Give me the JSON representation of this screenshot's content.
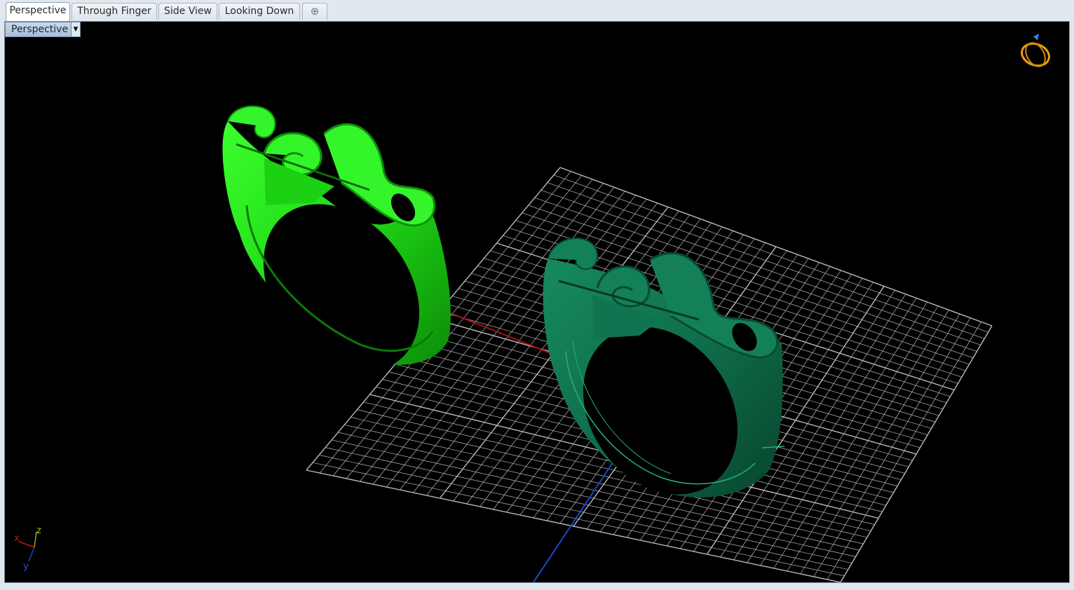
{
  "tabs": [
    {
      "label": "Perspective",
      "active": true
    },
    {
      "label": "Through Finger",
      "active": false
    },
    {
      "label": "Side View",
      "active": false
    },
    {
      "label": "Looking Down",
      "active": false
    }
  ],
  "add_tab_icon": "plus-icon",
  "viewport": {
    "title": "Perspective",
    "dropdown_icon": "triangle-down-icon",
    "navigator_icon": "rotate-ring-icon",
    "axis_triad": {
      "x": "x",
      "y": "y",
      "z": "z"
    }
  },
  "scene": {
    "objects": [
      {
        "name": "ring-bright-green",
        "color": "#22e61a"
      },
      {
        "name": "ring-dark-teal",
        "color": "#0f6e4b"
      }
    ],
    "grid_color": "#bbbbbb",
    "x_axis_color": "#b01010",
    "y_axis_color": "#1f45c8"
  }
}
